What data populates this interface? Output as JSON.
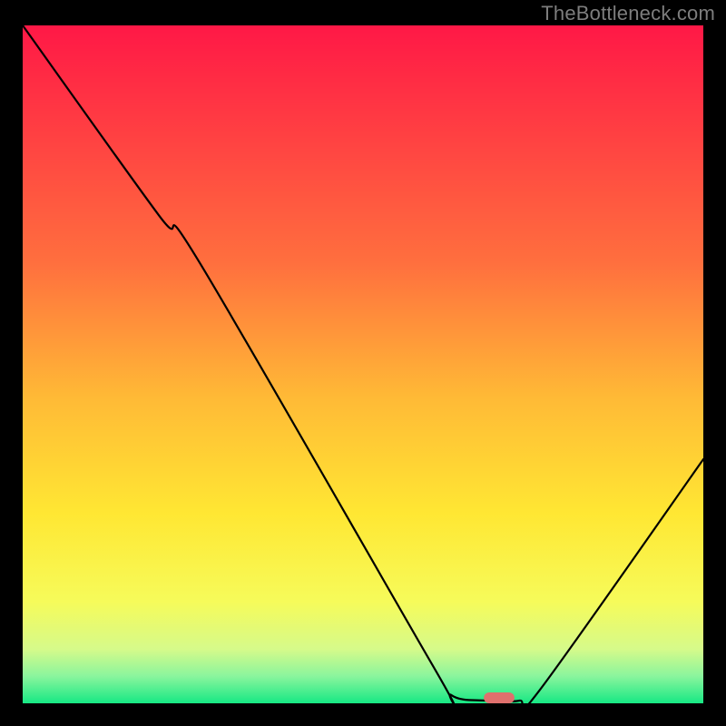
{
  "watermark": "TheBottleneck.com",
  "chart_data": {
    "type": "line",
    "title": "",
    "xlabel": "",
    "ylabel": "",
    "xlim": [
      0,
      100
    ],
    "ylim": [
      0,
      100
    ],
    "gradient_stops": [
      {
        "offset": 0,
        "color": "#ff1846"
      },
      {
        "offset": 35,
        "color": "#ff6f3e"
      },
      {
        "offset": 55,
        "color": "#ffba36"
      },
      {
        "offset": 72,
        "color": "#ffe733"
      },
      {
        "offset": 85,
        "color": "#f6fb5a"
      },
      {
        "offset": 92,
        "color": "#d6fa8a"
      },
      {
        "offset": 96,
        "color": "#8af59d"
      },
      {
        "offset": 100,
        "color": "#17e884"
      }
    ],
    "series": [
      {
        "name": "bottleneck-curve",
        "points": [
          {
            "x": 0,
            "y": 100
          },
          {
            "x": 20,
            "y": 72
          },
          {
            "x": 26,
            "y": 65
          },
          {
            "x": 60,
            "y": 6
          },
          {
            "x": 63,
            "y": 1.2
          },
          {
            "x": 68,
            "y": 0.4
          },
          {
            "x": 73,
            "y": 0.4
          },
          {
            "x": 76,
            "y": 2
          },
          {
            "x": 100,
            "y": 36
          }
        ]
      }
    ],
    "marker": {
      "x": 70,
      "y": 0.4,
      "w": 4.5,
      "h": 1.6,
      "color": "#e0706d"
    }
  }
}
